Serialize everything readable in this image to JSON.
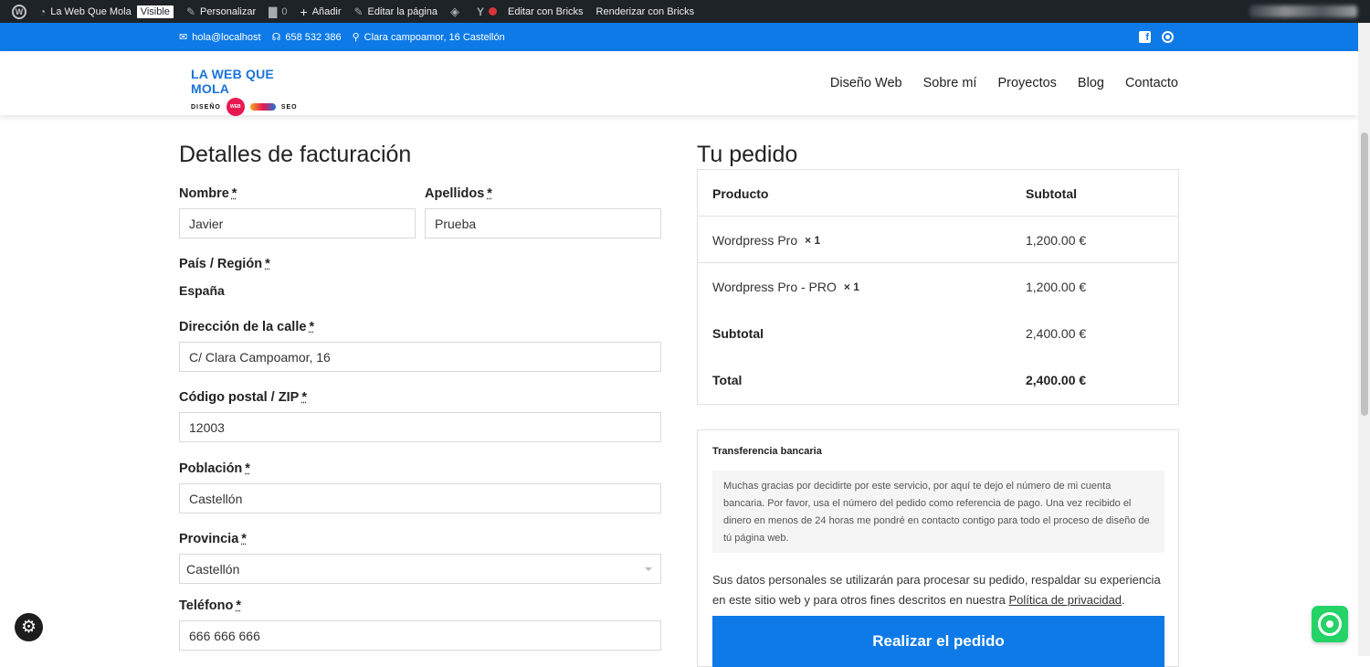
{
  "adminbar": {
    "site_name": "La Web Que Mola",
    "visible_badge": "Visible",
    "customize": "Personalizar",
    "comments_count": "0",
    "add_new": "Añadir",
    "edit_page": "Editar la página",
    "edit_bricks": "Editar con Bricks",
    "render_bricks": "Renderizar con Bricks"
  },
  "topbar": {
    "email": "hola@localhost",
    "phone": "658 532 386",
    "address": "Clara campoamor, 16 Castellón"
  },
  "logo": {
    "line1": "LA WEB QUE MOLA",
    "left_word": "DISEÑO",
    "badge": "WEB",
    "right_word": "SEO"
  },
  "nav": {
    "items": [
      "Diseño Web",
      "Sobre mí",
      "Proyectos",
      "Blog",
      "Contacto"
    ]
  },
  "billing": {
    "title": "Detalles de facturación",
    "required_mark": "*",
    "first_name_label": "Nombre",
    "first_name_value": "Javier",
    "last_name_label": "Apellidos",
    "last_name_value": "Prueba",
    "country_label": "País / Región",
    "country_value": "España",
    "street_label": "Dirección de la calle",
    "street_value": "C/ Clara Campoamor, 16",
    "zip_label": "Código postal / ZIP",
    "zip_value": "12003",
    "city_label": "Población",
    "city_value": "Castellón",
    "province_label": "Provincia",
    "province_value": "Castellón",
    "phone_label": "Teléfono",
    "phone_value": "666 666 666"
  },
  "order": {
    "title": "Tu pedido",
    "col_product": "Producto",
    "col_subtotal": "Subtotal",
    "items": [
      {
        "name": "Wordpress Pro",
        "qty": "× 1",
        "price": "1,200.00 €"
      },
      {
        "name": "Wordpress Pro - PRO",
        "qty": "× 1",
        "price": "1,200.00 €"
      }
    ],
    "subtotal_label": "Subtotal",
    "subtotal_value": "2,400.00 €",
    "total_label": "Total",
    "total_value": "2,400.00 €"
  },
  "payment": {
    "method_title": "Transferencia bancaria",
    "description": "Muchas gracias por decidirte por este servicio, por aquí te dejo el número de mi cuenta bancaria. Por favor, usa el número del pedido como referencia de pago. Una vez recibido el dinero en menos de 24 horas me pondré en contacto contigo para todo el proceso de diseño de tú página web.",
    "privacy_text": "Sus datos personales se utilizarán para procesar su pedido, respaldar su experiencia en este sitio web y para otros fines descritos en nuestra ",
    "privacy_link": "Política de privacidad",
    "privacy_end": ".",
    "place_order": "Realizar el pedido"
  },
  "colors": {
    "primary": "#0d7ae7",
    "adminbar": "#1d2327",
    "whatsapp": "#25d366"
  }
}
